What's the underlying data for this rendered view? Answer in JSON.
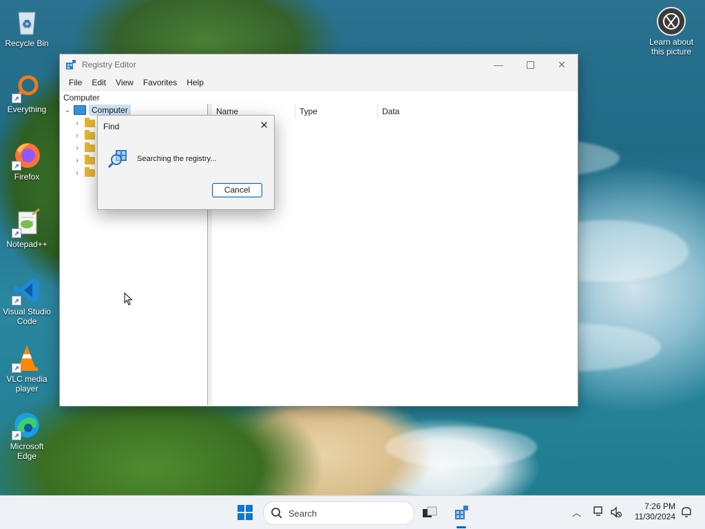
{
  "desktop": {
    "icons": [
      {
        "label": "Recycle Bin"
      },
      {
        "label": "Everything"
      },
      {
        "label": "Firefox"
      },
      {
        "label": "Notepad++"
      },
      {
        "label": "Visual Studio Code"
      },
      {
        "label": "VLC media player"
      },
      {
        "label": "Microsoft Edge"
      }
    ],
    "learn_about": "Learn about this picture"
  },
  "window": {
    "title": "Registry Editor",
    "menu": [
      "File",
      "Edit",
      "View",
      "Favorites",
      "Help"
    ],
    "address": "Computer",
    "tree_root": "Computer",
    "columns": [
      "Name",
      "Type",
      "Data"
    ]
  },
  "find_dialog": {
    "title": "Find",
    "message": "Searching the registry...",
    "cancel_label": "Cancel"
  },
  "taskbar": {
    "search_placeholder": "Search",
    "time": "7:26 PM",
    "date": "11/30/2024"
  },
  "colors": {
    "accent": "#0067c0",
    "selection": "#cce4f7",
    "folder": "#e9b730"
  }
}
